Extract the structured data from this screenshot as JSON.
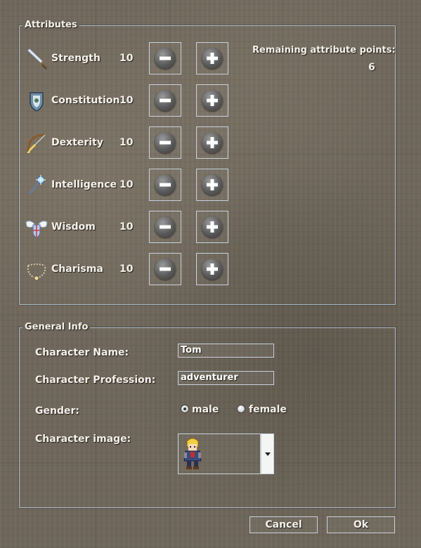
{
  "attributes_group": {
    "title": "Attributes",
    "remaining_label": "Remaining attribute points:",
    "remaining_value": "6",
    "items": [
      {
        "name": "Strength",
        "value": "10"
      },
      {
        "name": "Constitution",
        "value": "10"
      },
      {
        "name": "Dexterity",
        "value": "10"
      },
      {
        "name": "Intelligence",
        "value": "10"
      },
      {
        "name": "Wisdom",
        "value": "10"
      },
      {
        "name": "Charisma",
        "value": "10"
      }
    ]
  },
  "general_group": {
    "title": "General Info",
    "name_label": "Character Name:",
    "name_value": "Tom",
    "profession_label": "Character Profession:",
    "profession_value": "adventurer",
    "gender_label": "Gender:",
    "gender_options": [
      "male",
      "female"
    ],
    "gender_selected": "male",
    "image_label": "Character image:"
  },
  "buttons": {
    "cancel": "Cancel",
    "ok": "Ok"
  },
  "colors": {
    "border": "#a9b8c8",
    "text": "#f4f1ea"
  }
}
